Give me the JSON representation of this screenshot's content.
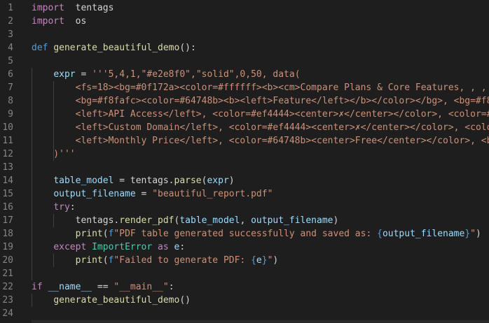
{
  "colors": {
    "background": "#1e1e1e",
    "line_number": "#858585",
    "keyword_control": "#c586c0",
    "keyword": "#569cd6",
    "function": "#dcdcaa",
    "variable": "#9cdcfe",
    "string": "#ce9178",
    "class": "#4ec9b0",
    "default": "#d4d4d4"
  },
  "lines": [
    {
      "n": "1",
      "tokens": [
        [
          "kw-ctrl",
          "import"
        ],
        [
          "",
          "  tentags"
        ]
      ]
    },
    {
      "n": "2",
      "tokens": [
        [
          "kw-ctrl",
          "import"
        ],
        [
          "",
          "  os"
        ]
      ]
    },
    {
      "n": "3",
      "tokens": []
    },
    {
      "n": "4",
      "tokens": [
        [
          "kw",
          "def"
        ],
        [
          "",
          " "
        ],
        [
          "fn",
          "generate_beautiful_demo"
        ],
        [
          "",
          "():"
        ]
      ]
    },
    {
      "n": "5",
      "tokens": []
    },
    {
      "n": "6",
      "tokens": [
        [
          "",
          "    "
        ],
        [
          "var",
          "expr"
        ],
        [
          "",
          " = "
        ],
        [
          "str",
          "'''5,4,1,\"#e2e8f0\",\"solid\",0,50, data("
        ]
      ]
    },
    {
      "n": "7",
      "tokens": [
        [
          "str",
          "        <fs=18><bg=#0f172a><color=#ffffff><b><cm>Compare Plans & Core Features, , , <b"
        ]
      ]
    },
    {
      "n": "8",
      "tokens": [
        [
          "str",
          "        <bg=#f8fafc><color=#64748b><b><left>Feature</left></b></color></bg>, <bg=#f8f"
        ]
      ]
    },
    {
      "n": "9",
      "tokens": [
        [
          "str",
          "        <left>API Access</left>, <color=#ef4444><center>✗</center></color>, <color=#2"
        ]
      ]
    },
    {
      "n": "10",
      "tokens": [
        [
          "str",
          "        <left>Custom Domain</left>, <color=#ef4444><center>✗</center></color>, <color"
        ]
      ]
    },
    {
      "n": "11",
      "tokens": [
        [
          "str",
          "        <left>Monthly Price</left>, <color=#64748b><center>Free</center></color>, <bg"
        ]
      ]
    },
    {
      "n": "12",
      "tokens": [
        [
          "str",
          "    )'''"
        ]
      ]
    },
    {
      "n": "13",
      "tokens": []
    },
    {
      "n": "14",
      "tokens": [
        [
          "",
          "    "
        ],
        [
          "var",
          "table_model"
        ],
        [
          "",
          " = tentags."
        ],
        [
          "fn",
          "parse"
        ],
        [
          "",
          "("
        ],
        [
          "var",
          "expr"
        ],
        [
          "",
          ")"
        ]
      ]
    },
    {
      "n": "15",
      "tokens": [
        [
          "",
          "    "
        ],
        [
          "var",
          "output_filename"
        ],
        [
          "",
          " = "
        ],
        [
          "str",
          "\"beautiful_report.pdf\""
        ]
      ]
    },
    {
      "n": "16",
      "tokens": [
        [
          "",
          "    "
        ],
        [
          "kw-ctrl",
          "try"
        ],
        [
          "",
          ":"
        ]
      ]
    },
    {
      "n": "17",
      "tokens": [
        [
          "",
          "        tentags."
        ],
        [
          "fn",
          "render_pdf"
        ],
        [
          "",
          "("
        ],
        [
          "var",
          "table_model"
        ],
        [
          "",
          ", "
        ],
        [
          "var",
          "output_filename"
        ],
        [
          "",
          ")"
        ]
      ]
    },
    {
      "n": "18",
      "tokens": [
        [
          "",
          "        "
        ],
        [
          "fn",
          "print"
        ],
        [
          "",
          "("
        ],
        [
          "kw",
          "f"
        ],
        [
          "str",
          "\"PDF table generated successfully and saved as: "
        ],
        [
          "kw",
          "{"
        ],
        [
          "var",
          "output_filename"
        ],
        [
          "kw",
          "}"
        ],
        [
          "str",
          "\""
        ],
        [
          "",
          ")"
        ]
      ]
    },
    {
      "n": "19",
      "tokens": [
        [
          "",
          "    "
        ],
        [
          "kw-ctrl",
          "except"
        ],
        [
          "",
          " "
        ],
        [
          "cls",
          "ImportError"
        ],
        [
          "",
          " "
        ],
        [
          "kw-ctrl",
          "as"
        ],
        [
          "",
          " "
        ],
        [
          "var",
          "e"
        ],
        [
          "",
          ":"
        ]
      ]
    },
    {
      "n": "20",
      "tokens": [
        [
          "",
          "        "
        ],
        [
          "fn",
          "print"
        ],
        [
          "",
          "("
        ],
        [
          "kw",
          "f"
        ],
        [
          "str",
          "\"Failed to generate PDF: "
        ],
        [
          "kw",
          "{"
        ],
        [
          "var",
          "e"
        ],
        [
          "kw",
          "}"
        ],
        [
          "str",
          "\""
        ],
        [
          "",
          ")"
        ]
      ]
    },
    {
      "n": "21",
      "tokens": []
    },
    {
      "n": "22",
      "tokens": [
        [
          "kw-ctrl",
          "if"
        ],
        [
          "",
          " "
        ],
        [
          "var",
          "__name__"
        ],
        [
          "",
          " == "
        ],
        [
          "str",
          "\"__main__\""
        ],
        [
          "",
          ":"
        ]
      ]
    },
    {
      "n": "23",
      "tokens": [
        [
          "",
          "    "
        ],
        [
          "fn",
          "generate_beautiful_demo"
        ],
        [
          "",
          "()"
        ]
      ]
    },
    {
      "n": "24",
      "tokens": []
    }
  ]
}
